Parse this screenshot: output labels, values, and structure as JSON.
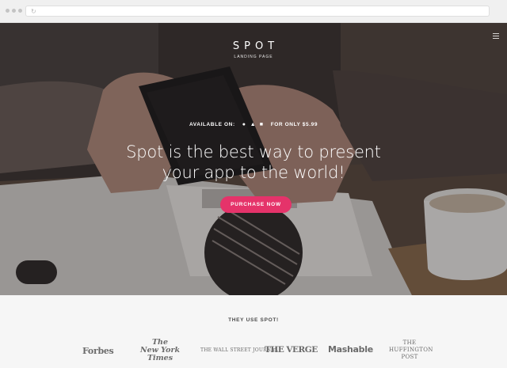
{
  "browser": {
    "reload_icon": "reload-icon"
  },
  "hero": {
    "logo_word": "SPOT",
    "logo_sub": "LANDING PAGE",
    "available_label": "AVAILABLE ON:",
    "price_label": "FOR ONLY $5.99",
    "platform_icons": [
      "apple-icon",
      "android-icon",
      "windows-icon"
    ],
    "headline_line1": "Spot is the best way to present",
    "headline_line2": "your app to the world!",
    "cta_label": "PURCHASE NOW",
    "colors": {
      "accent": "#e5336a",
      "text": "#ffffff"
    }
  },
  "press": {
    "title": "THEY USE SPOT!",
    "forbes": "Forbes",
    "nyt_line1": "The",
    "nyt_line2": "New York",
    "nyt_line3": "Times",
    "wsj": "THE WALL STREET JOURNAL",
    "verge": "THE VERGE",
    "mashable": "Mashable",
    "huff_line1": "THE",
    "huff_line2": "HUFFINGTON",
    "huff_line3": "POST"
  }
}
